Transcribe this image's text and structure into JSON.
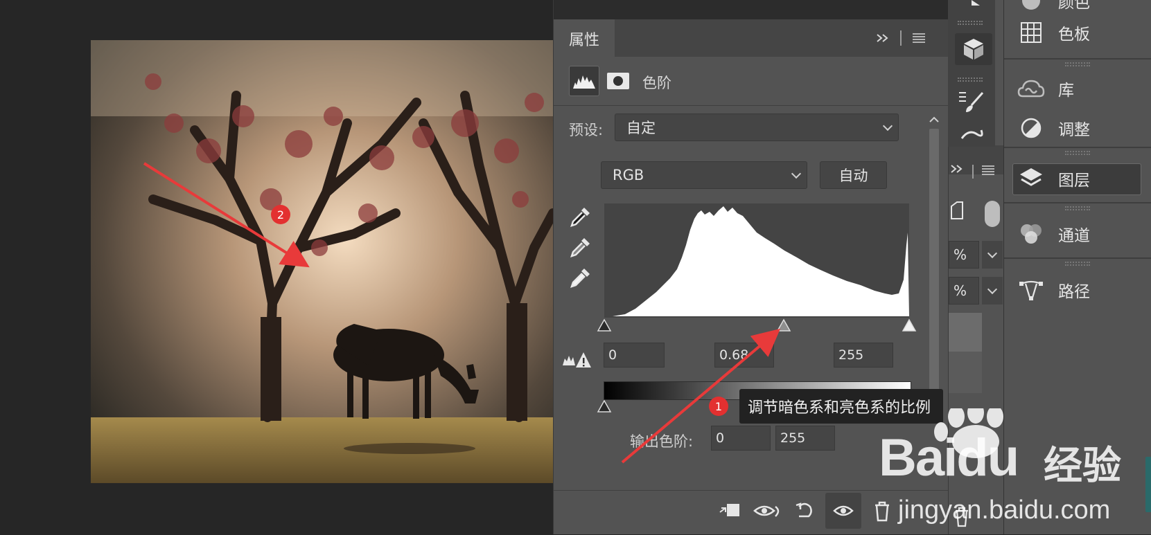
{
  "properties_panel": {
    "tab_label": "属性",
    "expand_icon": "double-chevron-right",
    "menu_icon": "hamburger",
    "adjustment_title": "色阶",
    "preset_label": "预设:",
    "preset_value": "自定",
    "channel_value": "RGB",
    "auto_button": "自动",
    "input_black": "0",
    "input_gamma": "0.68",
    "input_white": "255",
    "output_label": "输出色阶:",
    "output_black": "0",
    "output_white": "255",
    "eyedroppers": [
      "black-point-eyedropper",
      "gray-point-eyedropper",
      "white-point-eyedropper"
    ],
    "footer_icons": [
      "clip-to-layer",
      "view-previous-state",
      "reset",
      "toggle-visibility",
      "delete"
    ]
  },
  "middle_column": {
    "opacity_suffix_1": "%",
    "opacity_suffix_2": "%"
  },
  "right_dock": {
    "items": [
      {
        "label": "颜色",
        "icon": "color-icon"
      },
      {
        "label": "色板",
        "icon": "swatches-icon"
      },
      {
        "label": "库",
        "icon": "libraries-icon"
      },
      {
        "label": "调整",
        "icon": "adjustments-icon"
      },
      {
        "label": "图层",
        "icon": "layers-icon",
        "active": true
      },
      {
        "label": "通道",
        "icon": "channels-icon"
      },
      {
        "label": "路径",
        "icon": "paths-icon"
      }
    ]
  },
  "annotations": {
    "badge_1": "1",
    "badge_2": "2",
    "tooltip_text": "调节暗色系和亮色系的比例",
    "arrow_color": "#e83a3a"
  },
  "watermark": {
    "logo_text": "Baidu",
    "brand_text": "经验",
    "url": "jingyan.baidu.com"
  },
  "colors": {
    "app_background": "#262626",
    "panel_background": "#535353",
    "accent_red": "#e33030"
  }
}
